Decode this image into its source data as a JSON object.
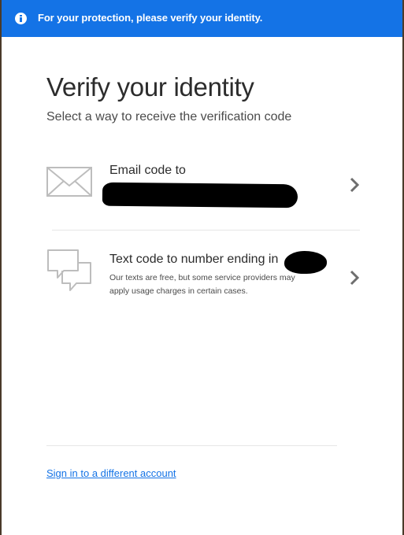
{
  "banner": {
    "message": "For your protection, please verify your identity.",
    "icon": "info-icon",
    "color": "#1473e6"
  },
  "title": "Verify your identity",
  "subtitle": "Select a way to receive the verification code",
  "options": [
    {
      "icon": "mail-icon",
      "label": "Email code to",
      "value": "[redacted]"
    },
    {
      "icon": "chat-icon",
      "label": "Text code to number ending in",
      "value": "[redacted]",
      "description": "Our texts are free, but some service providers may apply usage charges in certain cases."
    }
  ],
  "footer": {
    "link": "Sign in to a different account"
  }
}
